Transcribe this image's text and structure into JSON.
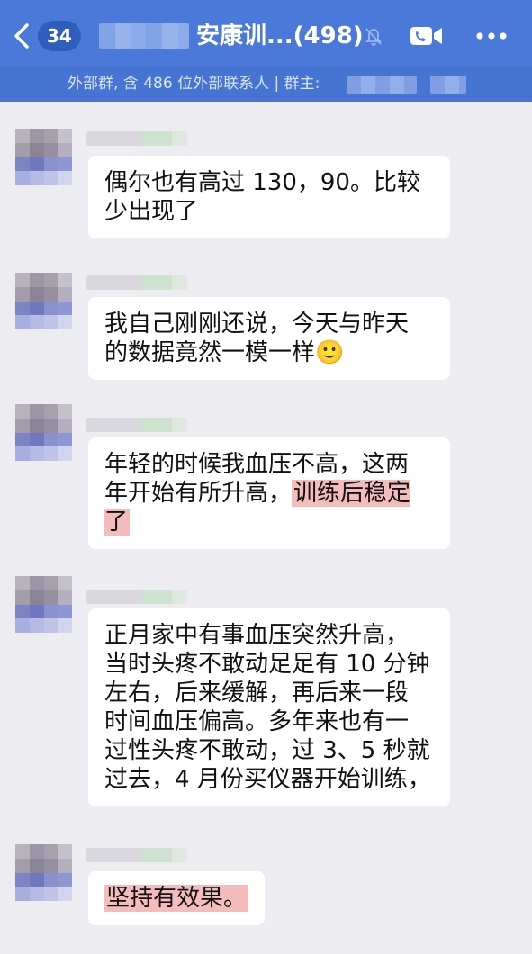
{
  "header": {
    "back_icon": "chevron-left-icon",
    "unread_count": "34",
    "title": "安康训...(498)",
    "mute_icon": "bell-slash-icon",
    "video_icon": "video-call-icon",
    "more_icon": "more-dots-icon",
    "subtitle": "外部群, 含 486 位外部联系人 | 群主:",
    "accent_color": "#4a79d9"
  },
  "messages": [
    {
      "text": "偶尔也有高过 130，90。比较\n少出现了"
    },
    {
      "text": "我自己刚刚还说，今天与昨天\n的数据竟然一模一样🙂"
    },
    {
      "text_before": "年轻的时候我血压不高，这两\n年开始有所升高，",
      "highlight": "训练后稳定\n了"
    },
    {
      "text": "正月家中有事血压突然升高，\n当时头疼不敢动足足有 10 分钟\n左右，后来缓解，再后来一段\n时间血压偏高。多年来也有一\n过性头疼不敢动，过 3、5 秒就\n过去，4 月份买仪器开始训练，"
    },
    {
      "highlight": "坚持有效果。"
    }
  ],
  "highlight_color": "#f5bcbc"
}
